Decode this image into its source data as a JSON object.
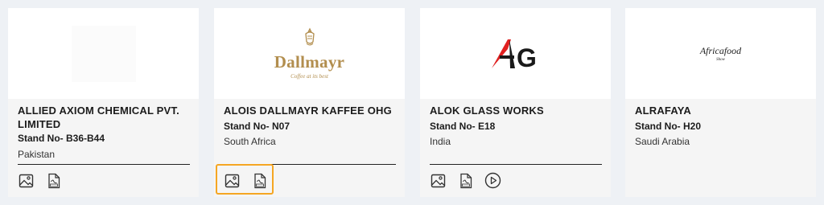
{
  "exhibitors": [
    {
      "name": "ALLIED AXIOM CHEMICAL PVT. LIMITED",
      "stand": "Stand No- B36-B44",
      "country": "Pakistan"
    },
    {
      "name": "ALOIS DALLMAYR KAFFEE OHG",
      "stand": "Stand No- N07",
      "country": "South Africa",
      "logo_text": "Dallmayr",
      "logo_tagline": "Coffee at its best"
    },
    {
      "name": "ALOK GLASS WORKS",
      "stand": "Stand No- E18",
      "country": "India",
      "logo_text": "AG"
    },
    {
      "name": "ALRAFAYA",
      "stand": "Stand No- H20",
      "country": "Saudi Arabia",
      "logo_text": "Africafood",
      "logo_sub": "Show"
    }
  ],
  "icons": {
    "gallery": "image-icon",
    "brochure": "pdf-icon",
    "video": "play-icon"
  },
  "colors": {
    "highlight": "#f5a623",
    "dallmayr_gold": "#b28e4e",
    "ag_red": "#e02020"
  }
}
